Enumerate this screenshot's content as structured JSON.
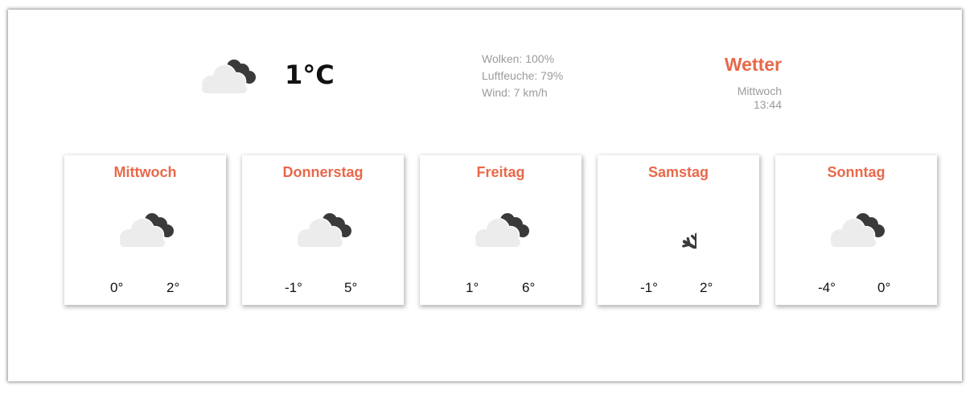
{
  "current": {
    "icon": "cloudy-icon",
    "temperature": "1°C"
  },
  "details": {
    "clouds": "Wolken: 100%",
    "humidity": "Luftfeuche: 79%",
    "wind": "Wind: 7 km/h"
  },
  "header": {
    "title": "Wetter",
    "day": "Mittwoch",
    "time": "13:44"
  },
  "forecast": [
    {
      "day": "Mittwoch",
      "icon": "cloudy-icon",
      "low": "0°",
      "high": "2°"
    },
    {
      "day": "Donnerstag",
      "icon": "cloudy-icon",
      "low": "-1°",
      "high": "5°"
    },
    {
      "day": "Freitag",
      "icon": "cloudy-icon",
      "low": "1°",
      "high": "6°"
    },
    {
      "day": "Samstag",
      "icon": "snowflake-icon",
      "low": "-1°",
      "high": "2°"
    },
    {
      "day": "Sonntag",
      "icon": "cloudy-icon",
      "low": "-4°",
      "high": "0°"
    }
  ],
  "colors": {
    "accent": "#e8694a",
    "muted_text": "#9b9b9b",
    "cloud_light": "#ececec",
    "cloud_dark": "#3a3a3a"
  }
}
